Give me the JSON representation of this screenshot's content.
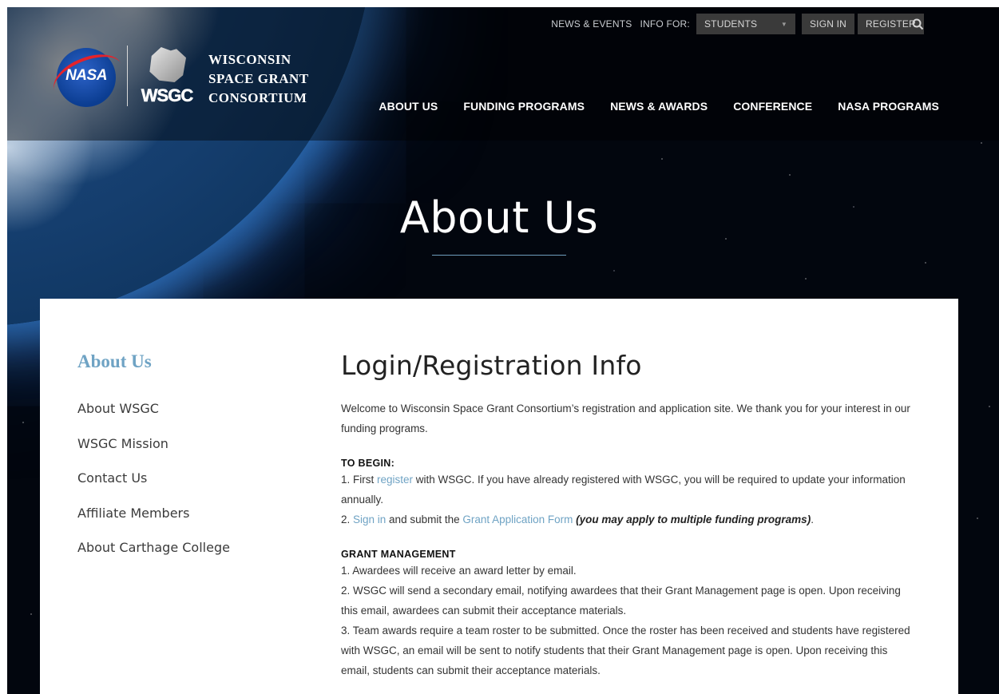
{
  "utility": {
    "news_events": "NEWS & EVENTS",
    "info_for_label": "INFO FOR:",
    "info_for_value": "STUDENTS",
    "sign_in": "SIGN IN",
    "register": "REGISTER"
  },
  "brand": {
    "nasa": "NASA",
    "wsgc": "WSGC",
    "line1": "WISCONSIN",
    "line2": "SPACE GRANT",
    "line3": "CONSORTIUM"
  },
  "nav": {
    "items": [
      "ABOUT US",
      "FUNDING PROGRAMS",
      "NEWS & AWARDS",
      "CONFERENCE",
      "NASA PROGRAMS"
    ]
  },
  "hero": {
    "title": "About Us"
  },
  "sidebar": {
    "title": "About Us",
    "items": [
      "About WSGC",
      "WSGC Mission",
      "Contact Us",
      "Affiliate Members",
      "About Carthage College"
    ]
  },
  "content": {
    "title": "Login/Registration Info",
    "welcome": "Welcome to Wisconsin Space Grant Consortium’s registration and application site.  We thank you for your interest in our funding programs.",
    "begin_heading": "TO BEGIN:",
    "begin_1_pre": "1. First ",
    "begin_1_link": "register",
    "begin_1_post": " with WSGC.  If you have already registered with WSGC, you will be required to update your information annually.",
    "begin_2_pre": "2. ",
    "begin_2_link1": "Sign in",
    "begin_2_mid": " and submit  the ",
    "begin_2_link2": "Grant Application Form",
    "begin_2_em": " (you may apply to multiple funding programs)",
    "begin_2_end": ".",
    "grant_heading": "GRANT MANAGEMENT",
    "grant_1": "1. Awardees will receive an award letter by email.",
    "grant_2": "2. WSGC will send a secondary email, notifying awardees that their Grant Management page is open.  Upon receiving this email, awardees can submit their acceptance materials.",
    "grant_3": "3. Team awards require a team roster to be submitted.  Once the roster has been received and students have registered with WSGC, an email will be sent to notify students that their Grant Management page is open.  Upon receiving this email, students can submit their acceptance materials."
  },
  "colors": {
    "accent": "#6fa3c4",
    "utility_button": "#3a3a3a"
  }
}
